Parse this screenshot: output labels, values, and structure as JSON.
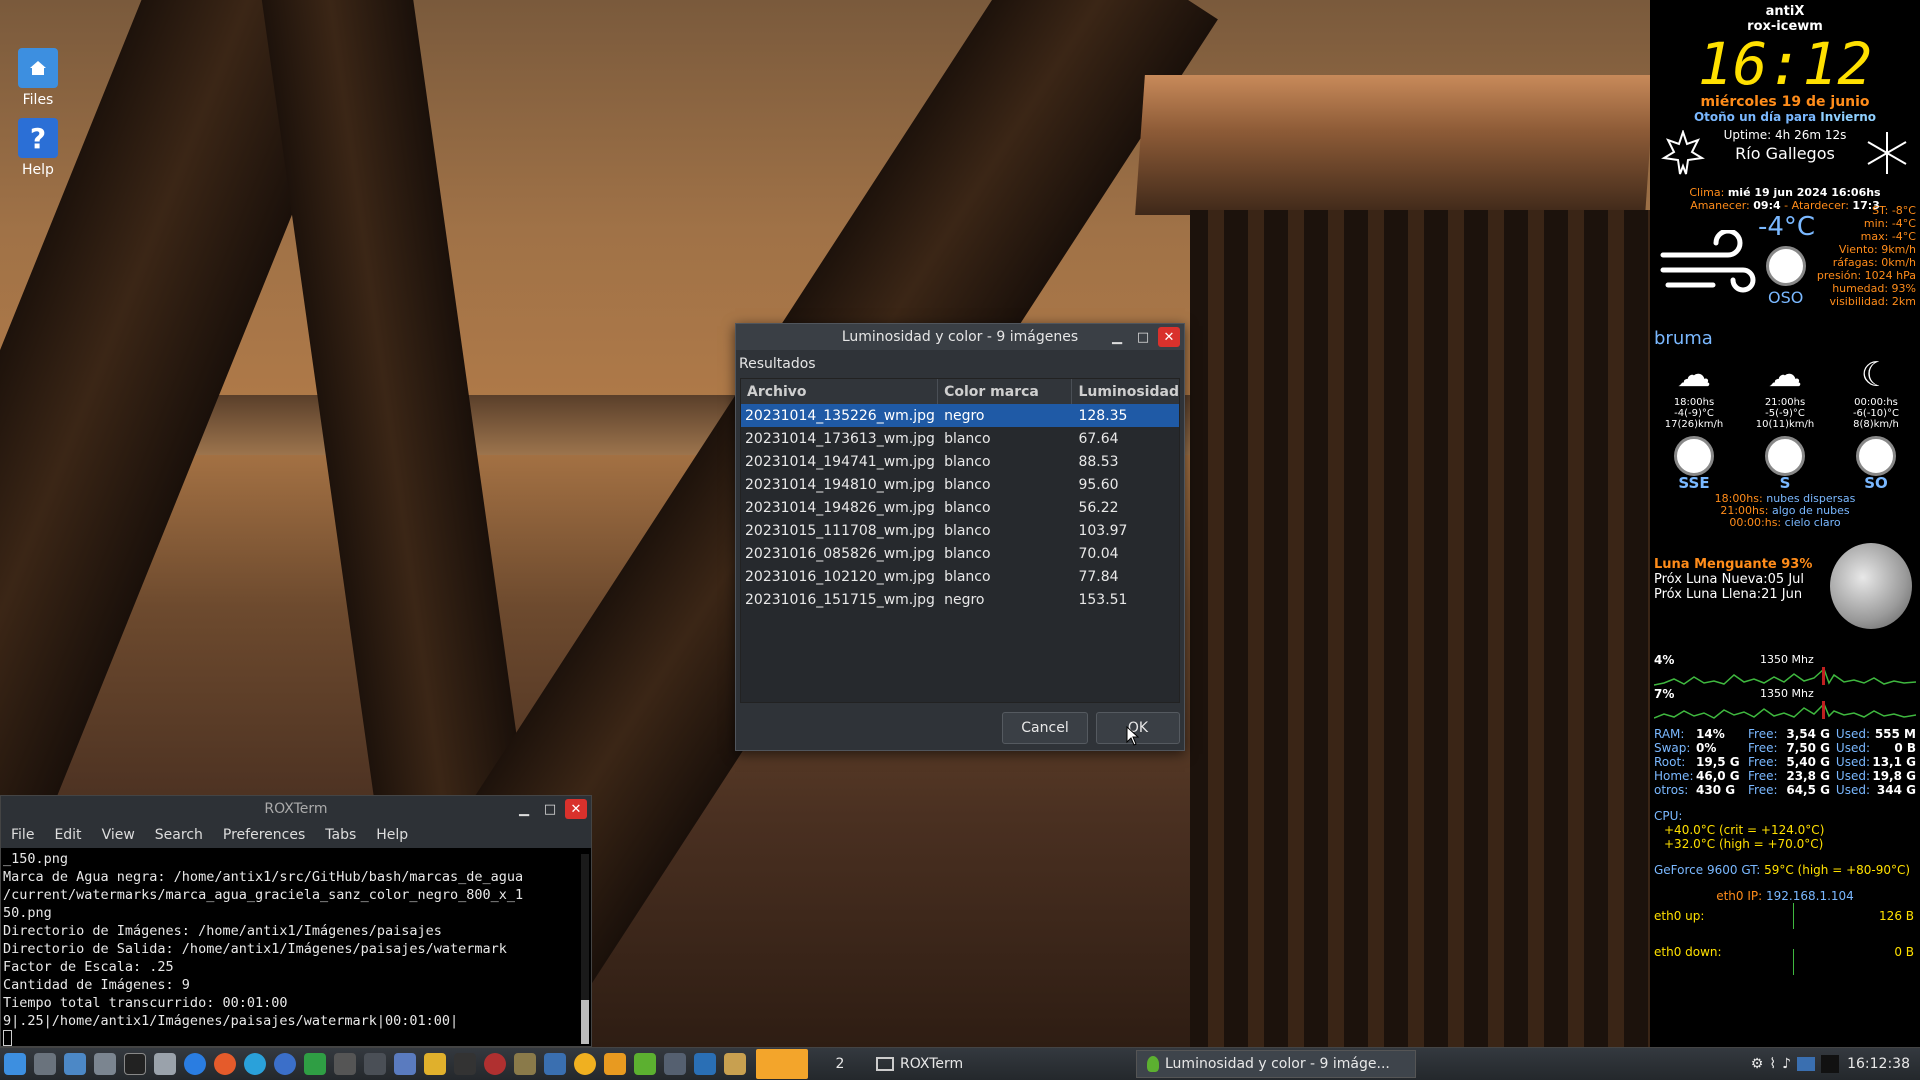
{
  "desktop_icons": [
    {
      "label": "Files",
      "icon": "home-folder-icon"
    },
    {
      "label": "Help",
      "icon": "help-icon"
    }
  ],
  "dialog": {
    "title": "Luminosidad y color - 9 imágenes",
    "section": "Resultados",
    "columns": [
      "Archivo",
      "Color marca",
      "Luminosidad"
    ],
    "rows": [
      [
        "20231014_135226_wm.jpg",
        "negro",
        "128.35"
      ],
      [
        "20231014_173613_wm.jpg",
        "blanco",
        "67.64"
      ],
      [
        "20231014_194741_wm.jpg",
        "blanco",
        "88.53"
      ],
      [
        "20231014_194810_wm.jpg",
        "blanco",
        "95.60"
      ],
      [
        "20231014_194826_wm.jpg",
        "blanco",
        "56.22"
      ],
      [
        "20231015_111708_wm.jpg",
        "blanco",
        "103.97"
      ],
      [
        "20231016_085826_wm.jpg",
        "blanco",
        "70.04"
      ],
      [
        "20231016_102120_wm.jpg",
        "blanco",
        "77.84"
      ],
      [
        "20231016_151715_wm.jpg",
        "negro",
        "153.51"
      ]
    ],
    "cancel_label": "Cancel",
    "ok_label": "OK"
  },
  "terminal": {
    "title": "ROXTerm",
    "menu": [
      "File",
      "Edit",
      "View",
      "Search",
      "Preferences",
      "Tabs",
      "Help"
    ],
    "lines": [
      "_150.png",
      "Marca de Agua negra: /home/antix1/src/GitHub/bash/marcas_de_agua",
      "/current/watermarks/marca_agua_graciela_sanz_color_negro_800_x_1",
      "50.png",
      "Directorio de Imágenes: /home/antix1/Imágenes/paisajes",
      "Directorio de Salida: /home/antix1/Imágenes/paisajes/watermark",
      "Factor de Escala: .25",
      "Cantidad de Imágenes: 9",
      "Tiempo total transcurrido: 00:01:00",
      "9|.25|/home/antix1/Imágenes/paisajes/watermark|00:01:00|",
      ""
    ]
  },
  "conky": {
    "distro": "antiX",
    "wm": "rox-icewm",
    "time": "16:12",
    "date": "miércoles 19 de junio",
    "season_a": "Otoño un día para",
    "season_b": "Invierno",
    "uptime": "Uptime: 4h 26m 12s",
    "city": "Río Gallegos",
    "clima_label": "Clima:",
    "clima": "mié 19 jun 2024 16:06hs",
    "sun_a_label": "Amanecer:",
    "sun_a": "09:4",
    "sun_b_label": "- Atardecer:",
    "sun_b": "17:3",
    "st": "ST: -8°C",
    "min": "min: -4°C",
    "max": "max: -4°C",
    "temp": "-4°C",
    "wind": "Viento: 9km/h",
    "gust": "ráfagas: 0km/h",
    "wind_dir": "OSO",
    "pressure": "presión: 1024 hPa",
    "humidity": "humedad: 93%",
    "visibility": "visibilidad: 2km",
    "condition": "bruma",
    "forecast": [
      {
        "time": "18:00hs",
        "temp": "-4(-9)°C",
        "wind": "17(26)km/h",
        "dir": "SSE"
      },
      {
        "time": "21:00hs",
        "temp": "-5(-9)°C",
        "wind": "10(11)km/h",
        "dir": "S"
      },
      {
        "time": "00:00:hs",
        "temp": "-6(-10)°C",
        "wind": "8(8)km/h",
        "dir": "SO"
      }
    ],
    "forecast_text": [
      {
        "t": "18:00hs:",
        "d": "nubes dispersas"
      },
      {
        "t": "21:00hs:",
        "d": "algo de nubes"
      },
      {
        "t": "00:00:hs:",
        "d": "cielo claro"
      }
    ],
    "moon_phase": "Luna Menguante 93%",
    "moon_new": "Próx Luna Nueva:05 Jul",
    "moon_full": "Próx Luna Llena:21 Jun",
    "cpu1": "4%",
    "cpu2": "7%",
    "freq": "1350 Mhz",
    "mem": [
      {
        "k": "RAM:",
        "v": "14%",
        "free": "3,54 G",
        "used": "555 M"
      },
      {
        "k": "Swap:",
        "v": "0%",
        "free": "7,50 G",
        "used": "0 B"
      },
      {
        "k": "Root:",
        "v": "19,5 G",
        "free": "5,40 G",
        "used": "13,1 G"
      },
      {
        "k": "Home:",
        "v": "46,0 G",
        "free": "23,8 G",
        "used": "19,8 G"
      },
      {
        "k": "otros:",
        "v": "430 G",
        "free": "64,5 G",
        "used": "344 G"
      }
    ],
    "free_label": "Free:",
    "used_label": "Used:",
    "cpu_label": "CPU:",
    "temp1": "+40.0°C  (crit = +124.0°C)",
    "temp2": "+32.0°C  (high = +70.0°C)",
    "gpu_label": "GeForce 9600 GT:",
    "gpu": "59°C (high = +80-90°C)",
    "ip_label": "eth0 IP:",
    "ip": "192.168.1.104",
    "up_label": "eth0 up:",
    "up": "126 B",
    "down_label": "eth0 down:",
    "down": "0 B"
  },
  "taskbar": {
    "workspace": "2",
    "tasks": [
      "ROXTerm",
      "Luminosidad y color - 9 imáge..."
    ],
    "clock": "16:12:38"
  }
}
